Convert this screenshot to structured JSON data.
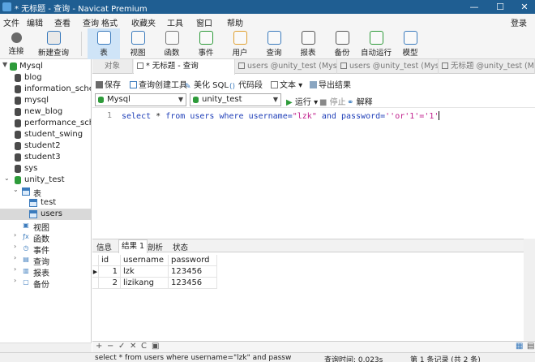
{
  "window": {
    "title": "* 无标题 - 查询 - Navicat Premium",
    "minimize": "—",
    "maximize": "☐",
    "close": "✕"
  },
  "menu": {
    "items": [
      "文件",
      "编辑",
      "查看",
      "查询",
      "格式",
      "收藏夹",
      "工具",
      "窗口",
      "帮助"
    ],
    "login": "登录"
  },
  "toolbar": {
    "connect": "连接",
    "new_query": "新建查询",
    "items": [
      {
        "label": "表",
        "icon": "table-icon",
        "active": true
      },
      {
        "label": "视图",
        "icon": "view-icon"
      },
      {
        "label": "函数",
        "icon": "function-icon"
      },
      {
        "label": "事件",
        "icon": "event-icon"
      },
      {
        "label": "用户",
        "icon": "user-icon"
      },
      {
        "label": "查询",
        "icon": "query-icon"
      },
      {
        "label": "报表",
        "icon": "report-icon"
      },
      {
        "label": "备份",
        "icon": "backup-icon"
      },
      {
        "label": "自动运行",
        "icon": "autorun-icon"
      },
      {
        "label": "模型",
        "icon": "model-icon"
      }
    ]
  },
  "sidebar": {
    "connection": "Mysql",
    "databases": [
      "blog",
      "information_schema",
      "mysql",
      "new_blog",
      "performance_schema",
      "student_swing",
      "student2",
      "student3",
      "sys"
    ],
    "open_db": "unity_test",
    "tables_node": "表",
    "tables": [
      "test",
      "users"
    ],
    "objects": [
      "视图",
      "函数",
      "事件",
      "查询",
      "报表",
      "备份"
    ]
  },
  "tabs": [
    {
      "label": "对象"
    },
    {
      "label": "* 无标题 - 查询"
    },
    {
      "label": "users @unity_test (Mysq..."
    },
    {
      "label": "users @unity_test (Mysq..."
    },
    {
      "label": "无标题 @unity_test (Mys..."
    }
  ],
  "query_toolbar": {
    "save": "保存",
    "builder": "查询创建工具",
    "beautify": "美化 SQL",
    "snippet": "代码段",
    "text": "文本",
    "export": "导出结果"
  },
  "selectors": {
    "connection": "Mysql",
    "database": "unity_test"
  },
  "run": {
    "run": "运行",
    "stop": "停止",
    "explain": "解释"
  },
  "editor": {
    "line_number": "1",
    "tokens": [
      {
        "t": "select ",
        "c": "kw"
      },
      {
        "t": "* ",
        "c": "plain"
      },
      {
        "t": "from ",
        "c": "kw"
      },
      {
        "t": "users ",
        "c": "kw"
      },
      {
        "t": "where ",
        "c": "kw"
      },
      {
        "t": "username=",
        "c": "kw"
      },
      {
        "t": "\"lzk\" ",
        "c": "str"
      },
      {
        "t": "and ",
        "c": "kw"
      },
      {
        "t": "password=",
        "c": "kw"
      },
      {
        "t": "''or'1'='1'",
        "c": "str"
      }
    ]
  },
  "result_tabs": [
    "信息",
    "结果 1",
    "剖析",
    "状态"
  ],
  "grid": {
    "columns": [
      "id",
      "username",
      "password"
    ],
    "rows": [
      [
        "1",
        "lzk",
        "123456"
      ],
      [
        "2",
        "lizikang",
        "123456"
      ]
    ]
  },
  "grid_bar": [
    "+",
    "−",
    "✓",
    "✕",
    "C",
    "▣"
  ],
  "status": {
    "sql": "select * from users where username=\"lzk\" and passw",
    "query_time": "查询时间: 0.023s",
    "records": "第 1 条记录 (共 2 条)"
  },
  "colors": {
    "titlebar": "#1f5e92",
    "accent": "#cfe4f7",
    "keyword": "#1f3fb8",
    "string": "#c01f8c"
  }
}
